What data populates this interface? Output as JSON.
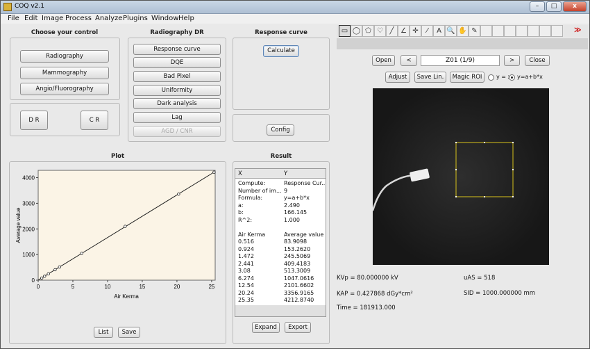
{
  "window": {
    "title": "COQ  v2.1",
    "min": "–",
    "max": "□",
    "close": "x"
  },
  "menu": [
    "File",
    "Edit",
    "Image",
    "Process",
    "Analyze",
    "Plugins",
    "Window",
    "Help"
  ],
  "control": {
    "header": "Choose your control",
    "modes": [
      "Radiography",
      "Mammography",
      "Angio/Fluorography"
    ],
    "dr": "D R",
    "cr": "C R"
  },
  "radiography": {
    "header": "Radiography DR",
    "items": [
      "Response curve",
      "DQE",
      "Bad Pixel",
      "Uniformity",
      "Dark analysis",
      "Lag",
      "AGD / CNR"
    ]
  },
  "response": {
    "header": "Response curve",
    "calculate": "Calculate",
    "config": "Config"
  },
  "plot": {
    "header": "Plot",
    "list": "List",
    "save": "Save"
  },
  "result": {
    "header": "Result",
    "columns": [
      "X",
      "Y"
    ],
    "rows": [
      [
        "Compute:",
        "Response Cur..."
      ],
      [
        "Number of im...",
        "9"
      ],
      [
        "Formula:",
        "y=a+b*x"
      ],
      [
        "a:",
        "2.490"
      ],
      [
        "b:",
        "166.145"
      ],
      [
        "R^2:",
        "1.000"
      ],
      [
        "",
        ""
      ],
      [
        "Air Kerma",
        "Average value"
      ],
      [
        "0.516",
        "83.9098"
      ],
      [
        "0.924",
        "153.2620"
      ],
      [
        "1.472",
        "245.5069"
      ],
      [
        "2.441",
        "409.4183"
      ],
      [
        "3.08",
        "513.3009"
      ],
      [
        "6.274",
        "1047.0616"
      ],
      [
        "12.54",
        "2101.6602"
      ],
      [
        "20.24",
        "3356.9165"
      ],
      [
        "25.35",
        "4212.8740"
      ]
    ],
    "expand": "Expand",
    "export": "Export"
  },
  "viewer": {
    "tools": [
      "rect-icon",
      "oval-icon",
      "polygon-icon",
      "freehand-icon",
      "line-icon",
      "angle-icon",
      "point-icon",
      "wand-icon",
      "text-icon",
      "magnifier-icon",
      "hand-icon",
      "dropper-icon"
    ],
    "tool_glyphs": [
      "▭",
      "◯",
      "⬠",
      "♡",
      "╱",
      "∠",
      "✛",
      "⁄",
      "A",
      "🔍",
      "✋",
      "✎"
    ],
    "more": "≫",
    "open": "Open",
    "prev": "<",
    "slice": "Z01 (1/9)",
    "next": ">",
    "close": "Close",
    "adjust": "Adjust",
    "save_lin": "Save Lin.",
    "magic_roi": "Magic ROI",
    "radio1": "y = x",
    "radio2": "y=a+b*x"
  },
  "info": {
    "kvp": "KVp = 80.000000 kV",
    "uas": "uAS = 518",
    "kap": "KAP = 0.427868 dGy*cm²",
    "sid": "SID = 1000.000000 mm",
    "time": "Time = 181913.000"
  },
  "chart_data": {
    "type": "line",
    "xlabel": "Air Kerma",
    "ylabel": "Average value",
    "xlim": [
      0,
      25
    ],
    "ylim": [
      0,
      4200
    ],
    "xticks": [
      0,
      5,
      10,
      15,
      20,
      25
    ],
    "yticks": [
      0,
      1000,
      2000,
      3000,
      4000
    ],
    "points": [
      [
        0.516,
        83.9098
      ],
      [
        0.924,
        153.262
      ],
      [
        1.472,
        245.5069
      ],
      [
        2.441,
        409.4183
      ],
      [
        3.08,
        513.3009
      ],
      [
        6.274,
        1047.0616
      ],
      [
        12.54,
        2101.6602
      ],
      [
        20.24,
        3356.9165
      ],
      [
        25.35,
        4212.874
      ]
    ],
    "fit": {
      "a": 2.49,
      "b": 166.145
    },
    "grid": false
  },
  "colors": {
    "roi": "#d8c21a",
    "fit_line": "#222222",
    "plot_bg": "#fbf4e6"
  }
}
